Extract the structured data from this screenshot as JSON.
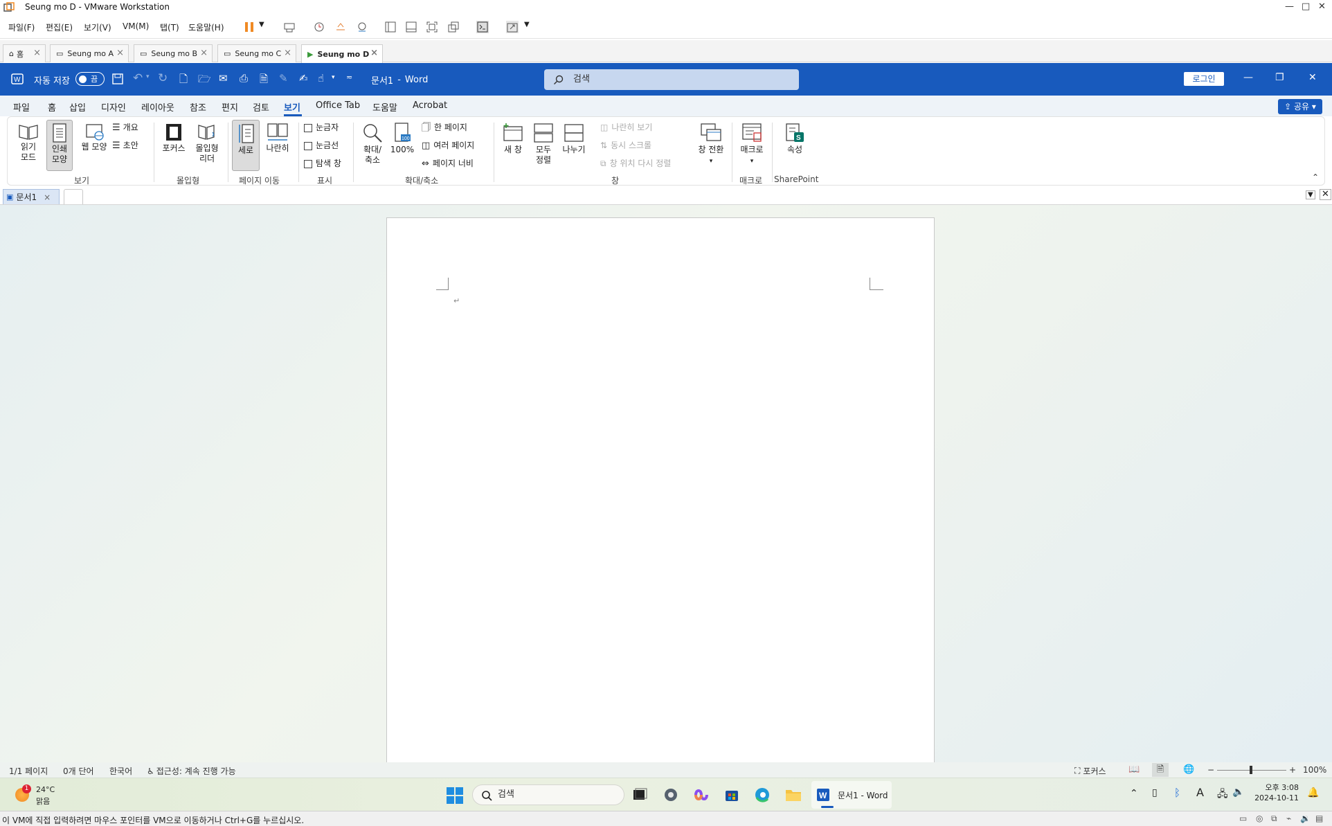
{
  "vm": {
    "title": "Seung mo D - VMware Workstation",
    "menu": [
      "파일(F)",
      "편집(E)",
      "보기(V)",
      "VM(M)",
      "탭(T)",
      "도움말(H)"
    ],
    "tabs": [
      {
        "label": "홈"
      },
      {
        "label": "Seung mo A"
      },
      {
        "label": "Seung mo B"
      },
      {
        "label": "Seung mo C"
      },
      {
        "label": "Seung mo D"
      }
    ],
    "hint": "이 VM에 직접 입력하려면 마우스 포인터를 VM으로 이동하거나 Ctrl+G를 누르십시오."
  },
  "word": {
    "autosave_label": "자동 저장",
    "autosave_state": "끔",
    "doc_title": "문서1",
    "app_name": "Word",
    "title_sep": "-",
    "search_placeholder": "검색",
    "login": "로그인",
    "share": "공유",
    "ribbon_tabs": [
      "파일",
      "홈",
      "삽입",
      "디자인",
      "레이아웃",
      "참조",
      "편지",
      "검토",
      "보기",
      "Office Tab",
      "도움말",
      "Acrobat"
    ],
    "ribbon": {
      "read_mode": [
        "읽기",
        "모드"
      ],
      "print_layout": [
        "인쇄",
        "모양"
      ],
      "web_layout": "웹 모양",
      "outline": "개요",
      "draft": "초안",
      "group_views": "보기",
      "focus": "포커스",
      "immersive_reader": [
        "몰입형",
        "리더"
      ],
      "group_immersive": "몰입형",
      "vertical": "세로",
      "side_to_side": "나란히",
      "group_page_movement": "페이지 이동",
      "ruler": "눈금자",
      "gridlines": "눈금선",
      "nav_pane": "탐색 창",
      "group_show": "표시",
      "zoom": [
        "확대/",
        "축소"
      ],
      "zoom_100": "100%",
      "one_page": "한 페이지",
      "multiple_pages": "여러 페이지",
      "page_width": "페이지 너비",
      "group_zoom": "확대/축소",
      "new_window": "새 창",
      "arrange_all": [
        "모두",
        "정렬"
      ],
      "split": "나누기",
      "view_side_by_side": "나란히 보기",
      "sync_scroll": "동시 스크롤",
      "reset_window_pos": "창 위치 다시 정렬",
      "switch_windows": "창 전환",
      "group_window": "창",
      "macros": "매크로",
      "group_macros": "매크로",
      "properties": "속성",
      "group_sharepoint": "SharePoint"
    },
    "doc_tab": "문서1",
    "status": {
      "page": "1/1 페이지",
      "words": "0개 단어",
      "language": "한국어",
      "accessibility": "접근성: 계속 진행 가능",
      "focus": "포커스",
      "zoom": "100%",
      "zoom_minus": "−",
      "zoom_plus": "+"
    }
  },
  "taskbar": {
    "weather_temp": "24°C",
    "weather_desc": "맑음",
    "weather_badge": "1",
    "search": "검색",
    "word_app": "문서1 - Word",
    "time": "오후 3:08",
    "date": "2024-10-11"
  },
  "colors": {
    "word_blue": "#185abd",
    "vm_orange": "#f08a24"
  }
}
